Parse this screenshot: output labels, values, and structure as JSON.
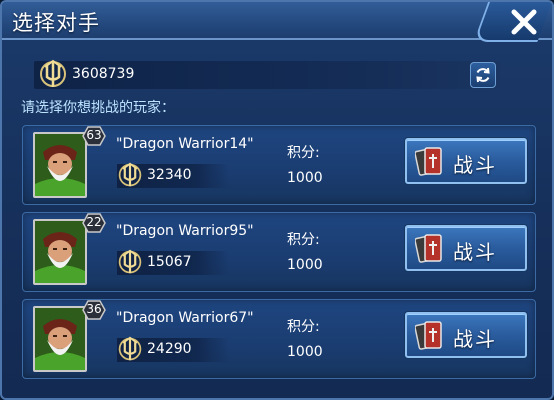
{
  "dialog": {
    "title": "选择对手",
    "close_icon": "close-x-icon"
  },
  "score": {
    "icon": "trident-emblem-icon",
    "value": "3608739",
    "refresh_icon": "refresh-icon"
  },
  "prompt": "请选择你想挑战的玩家：",
  "players": [
    {
      "level": "63",
      "name": "\"Dragon Warrior14\"",
      "power": "32340",
      "points_label": "积分:",
      "points": "1000",
      "fight_label": "战斗"
    },
    {
      "level": "22",
      "name": "\"Dragon Warrior95\"",
      "power": "15067",
      "points_label": "积分:",
      "points": "1000",
      "fight_label": "战斗"
    },
    {
      "level": "36",
      "name": "\"Dragon Warrior67\"",
      "power": "24290",
      "points_label": "积分:",
      "points": "1000",
      "fight_label": "战斗"
    }
  ],
  "colors": {
    "panel": "#17325e",
    "title_bar": "#24497f",
    "prompt_text": "#bde3ff",
    "button": "#2a5c9e"
  }
}
